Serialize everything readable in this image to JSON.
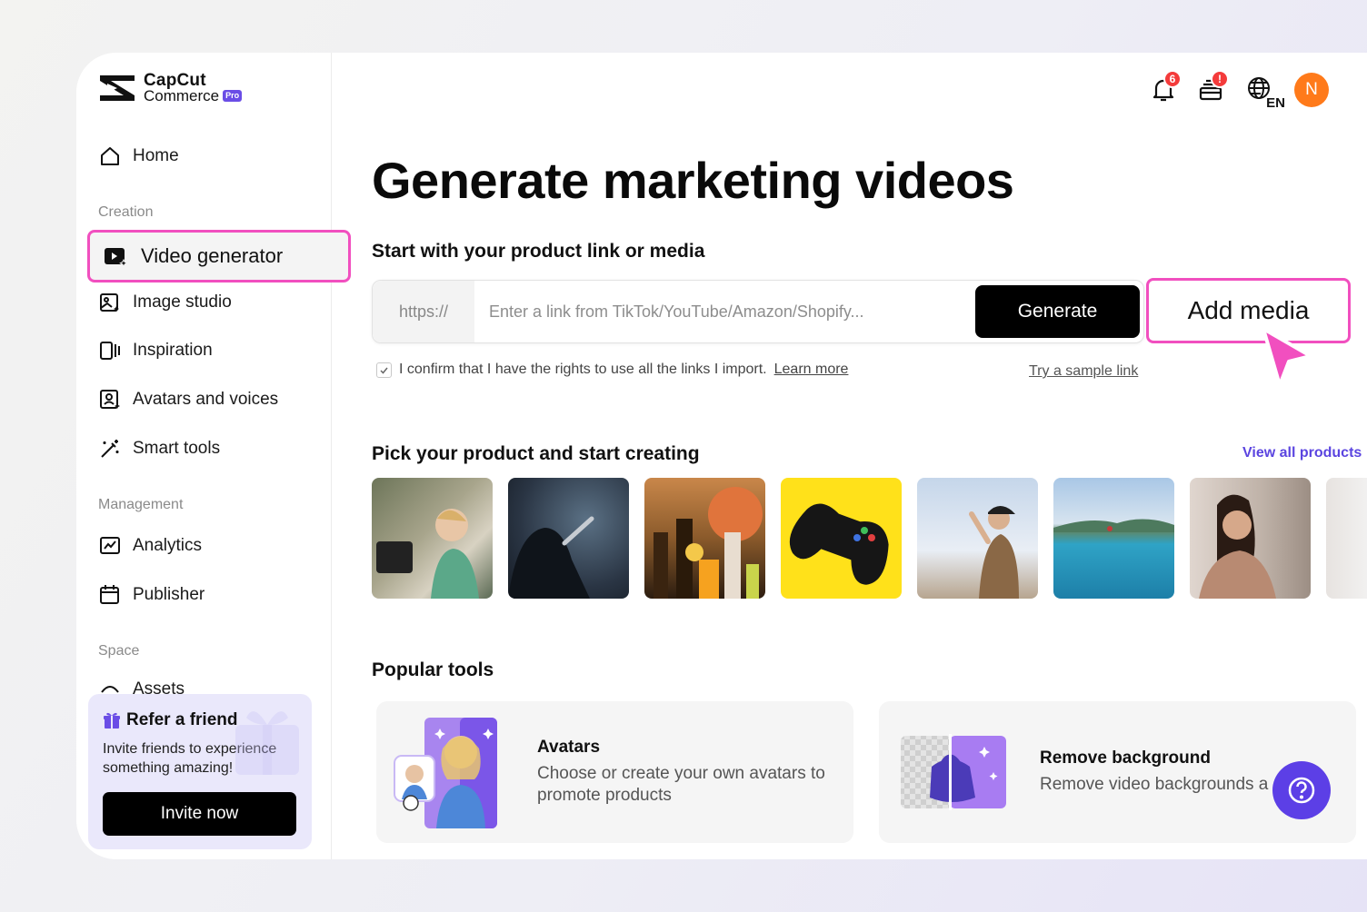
{
  "brand": {
    "line1": "CapCut",
    "line2": "Commerce",
    "badge": "Pro"
  },
  "sidebar": {
    "home": "Home",
    "section_creation": "Creation",
    "active_item": "Video generator",
    "items_creation": [
      "Image studio",
      "Inspiration",
      "Avatars and voices",
      "Smart tools"
    ],
    "section_management": "Management",
    "items_management": [
      "Analytics",
      "Publisher"
    ],
    "section_space": "Space",
    "assets": "Assets",
    "refer": {
      "title": "Refer a friend",
      "desc": "Invite friends to experience something amazing!",
      "button": "Invite now"
    }
  },
  "topbar": {
    "notification_count": "6",
    "tasks_badge": "!",
    "lang": "EN",
    "avatar_initial": "N"
  },
  "main": {
    "title": "Generate marketing videos",
    "subtitle": "Start with your product link or media",
    "link_prefix": "https://",
    "link_placeholder": "Enter a link from TikTok/YouTube/Amazon/Shopify...",
    "generate": "Generate",
    "add_media": "Add media",
    "confirm_text": "I confirm that I have the rights to use all the links I import.",
    "learn_more": "Learn more",
    "sample_link": "Try a sample link",
    "pick_title": "Pick your product and start creating",
    "view_all": "View all products",
    "popular_title": "Popular tools",
    "tools": [
      {
        "title": "Avatars",
        "desc": "Choose or create your own avatars to promote products"
      },
      {
        "title": "Remove background",
        "desc": "Remove video backgrounds a"
      }
    ]
  },
  "colors": {
    "accent": "#5b45e0",
    "highlight": "#f14fbf",
    "avatar": "#ff7a1a",
    "badge": "#f43b3b"
  }
}
